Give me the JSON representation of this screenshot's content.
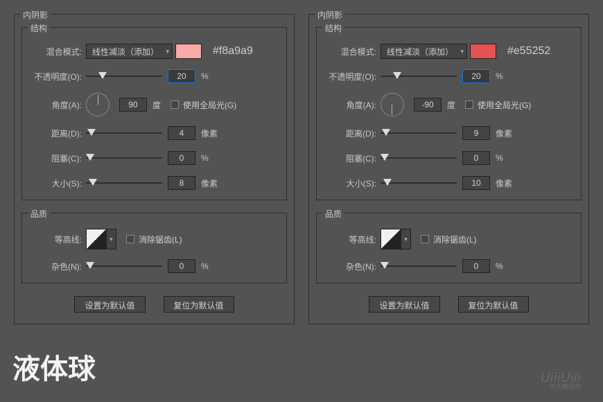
{
  "footerTitle": "液体球",
  "watermark": "UiiiUiii",
  "watermarkSub": "优优教程网",
  "labels": {
    "panelTitle": "内阴影",
    "structure": "结构",
    "quality": "品质",
    "blendMode": "混合模式:",
    "opacity": "不透明度(O):",
    "angle": "角度(A):",
    "degree": "度",
    "useGlobal": "使用全局光(G)",
    "distance": "距离(D):",
    "choke": "阻塞(C):",
    "size": "大小(S):",
    "contour": "等高线:",
    "antialias": "消除锯齿(L)",
    "noise": "杂色(N):",
    "percent": "%",
    "pixel": "像素",
    "makeDefault": "设置为默认值",
    "resetDefault": "复位为默认值"
  },
  "panels": [
    {
      "blendModeValue": "线性减淡（添加）",
      "swatchColor": "#f8a9a9",
      "hexLabel": "#f8a9a9",
      "opacity": "20",
      "angle": "90",
      "needleRot": -90,
      "distance": "4",
      "choke": "0",
      "size": "8",
      "noise": "0"
    },
    {
      "blendModeValue": "线性减淡（添加）",
      "swatchColor": "#e55252",
      "hexLabel": "#e55252",
      "opacity": "20",
      "angle": "-90",
      "needleRot": 90,
      "distance": "9",
      "choke": "0",
      "size": "10",
      "noise": "0"
    }
  ]
}
